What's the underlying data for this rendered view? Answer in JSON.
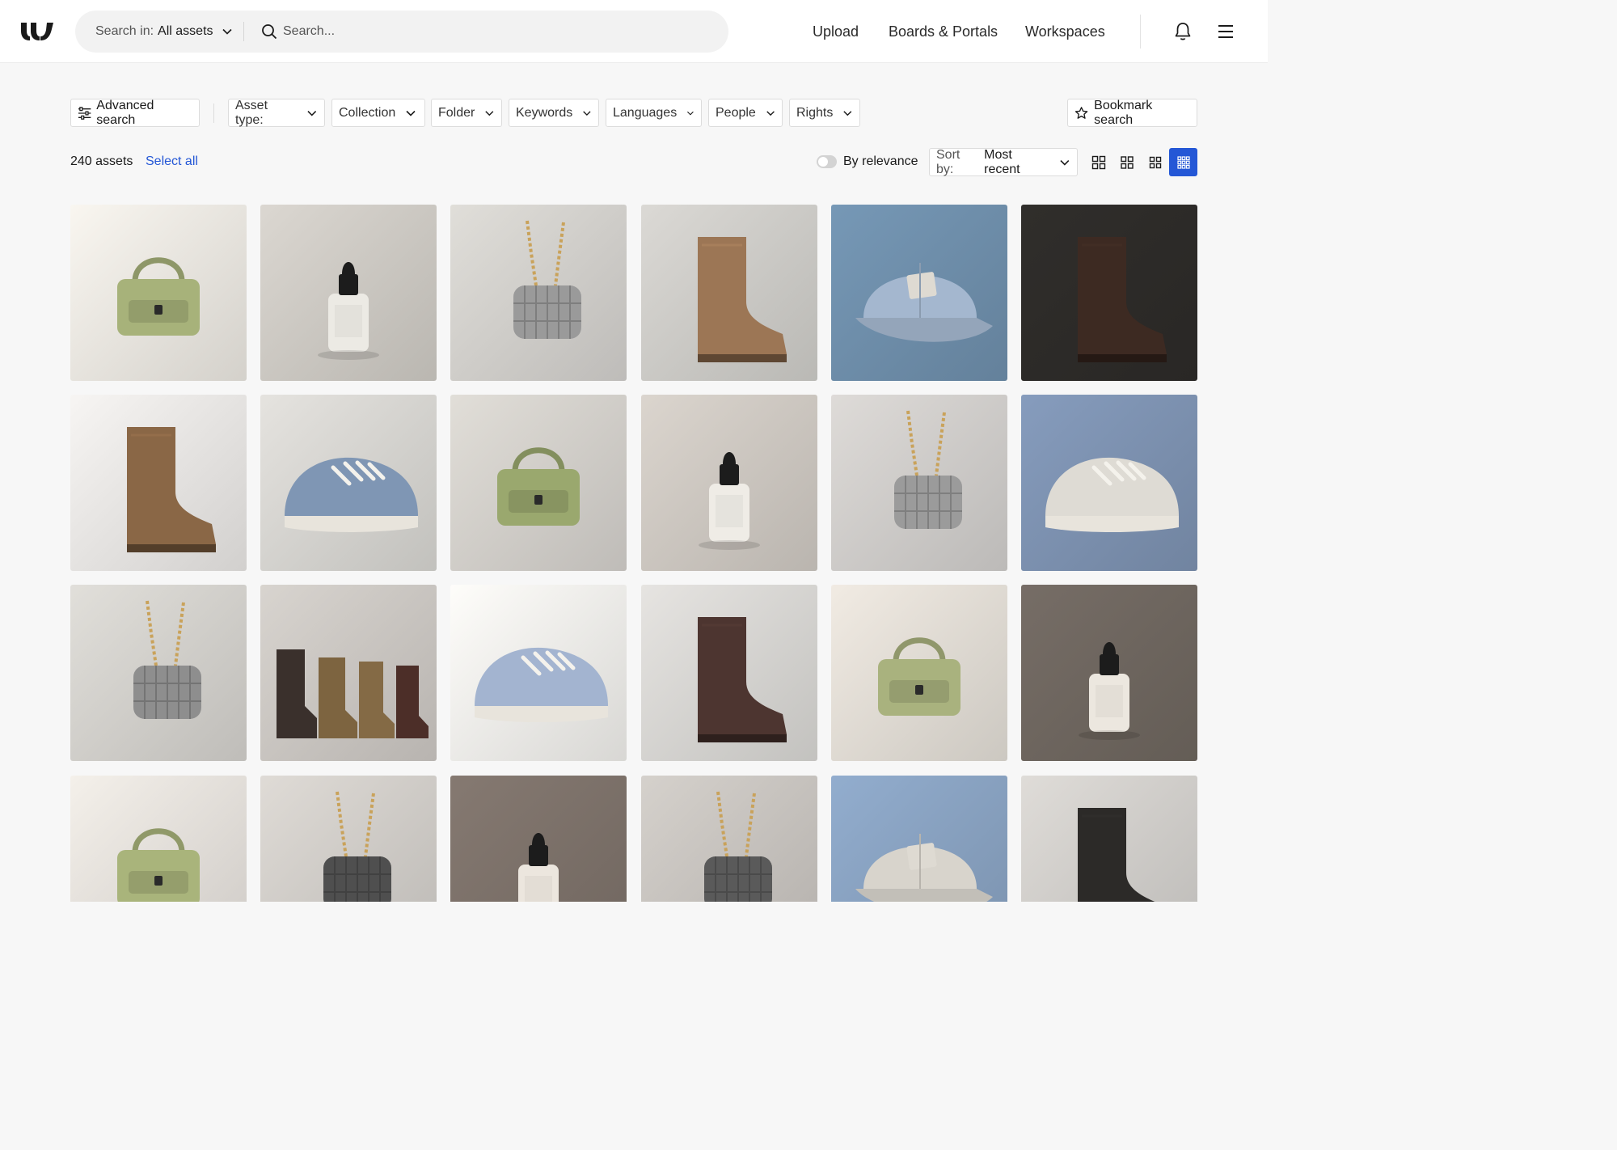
{
  "header": {
    "search_scope_label": "Search in:",
    "search_scope_value": "All assets",
    "search_placeholder": "Search...",
    "nav_upload": "Upload",
    "nav_boards": "Boards & Portals",
    "nav_workspaces": "Workspaces"
  },
  "filters": {
    "advanced_search": "Advanced search",
    "asset_type": "Asset type:",
    "collection": "Collection",
    "folder": "Folder",
    "keywords": "Keywords",
    "languages": "Languages",
    "people": "People",
    "rights": "Rights",
    "bookmark_search": "Bookmark search"
  },
  "results": {
    "count": "240 assets",
    "select_all": "Select all",
    "relevance_label": "By relevance",
    "relevance_on": false,
    "sort_label": "Sort by:",
    "sort_value": "Most recent",
    "view_modes": [
      "large-grid",
      "medium-grid",
      "small-grid",
      "dense-grid"
    ],
    "active_view": "dense-grid"
  },
  "colors": {
    "accent": "#2457d6",
    "background": "#f7f7f7"
  },
  "assets": [
    {
      "subject": "handbag",
      "bg": "#ebe8e2",
      "accent": "#a7b27a"
    },
    {
      "subject": "dropper",
      "bg": "#cfcbc5",
      "accent": "#eceae4"
    },
    {
      "subject": "chain-bag",
      "bg": "#d3d1cd",
      "accent": "#9a9a9a"
    },
    {
      "subject": "boot",
      "bg": "#cfcdc9",
      "accent": "#9c7655"
    },
    {
      "subject": "cap",
      "bg": "#6f8fac",
      "accent": "#a4b7cf"
    },
    {
      "subject": "boot",
      "bg": "#2d2b29",
      "accent": "#3d2a22"
    },
    {
      "subject": "boot",
      "bg": "#e9e7e5",
      "accent": "#8a6746"
    },
    {
      "subject": "sneaker",
      "bg": "#d8d6d2",
      "accent": "#7f96b4"
    },
    {
      "subject": "handbag",
      "bg": "#d4d1cc",
      "accent": "#9aa86e"
    },
    {
      "subject": "dropper",
      "bg": "#cfc9c2",
      "accent": "#efece6"
    },
    {
      "subject": "chain-bag",
      "bg": "#d1cfcc",
      "accent": "#9b9b9b"
    },
    {
      "subject": "sneaker",
      "bg": "#7e93b2",
      "accent": "#dedbd4"
    },
    {
      "subject": "chain-bag",
      "bg": "#d4d2ce",
      "accent": "#8e8e8e"
    },
    {
      "subject": "boots-row",
      "bg": "#ccc8c3",
      "accent": "#3a302c"
    },
    {
      "subject": "sneaker",
      "bg": "#f0efec",
      "accent": "#a3b4d0"
    },
    {
      "subject": "boot",
      "bg": "#d9d7d4",
      "accent": "#4d3530"
    },
    {
      "subject": "handbag",
      "bg": "#e3ded6",
      "accent": "#a9b27e"
    },
    {
      "subject": "dropper",
      "bg": "#6f6760",
      "accent": "#ece7df"
    },
    {
      "subject": "handbag",
      "bg": "#e6e2dd",
      "accent": "#a9b47b"
    },
    {
      "subject": "chain-bag",
      "bg": "#d2cfca",
      "accent": "#4f4f4f"
    },
    {
      "subject": "dropper",
      "bg": "#7d726b",
      "accent": "#ece6de"
    },
    {
      "subject": "chain-bag",
      "bg": "#c9c5c0",
      "accent": "#5a5a5a"
    },
    {
      "subject": "cap",
      "bg": "#8aa3c2",
      "accent": "#d8d4cc"
    },
    {
      "subject": "boot",
      "bg": "#d2d0cc",
      "accent": "#2c2a28"
    }
  ]
}
